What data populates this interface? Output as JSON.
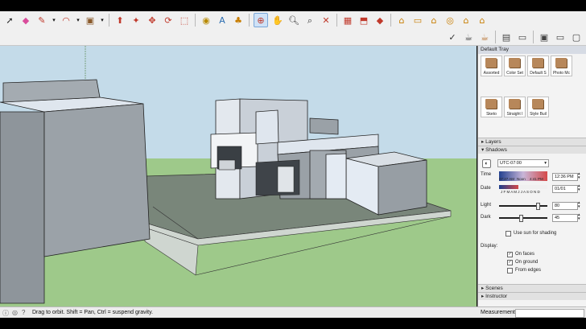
{
  "toolbar": {
    "row1_icons": [
      "select-icon",
      "eraser-icon",
      "pencil-icon",
      "dropdown-icon",
      "arc-icon",
      "dropdown-icon",
      "rectangle-icon",
      "dropdown-icon",
      "push-pull-icon",
      "follow-me-icon",
      "move-icon",
      "rotate-icon",
      "scale-icon",
      "tape-measure-icon",
      "paint-bucket-icon",
      "text-icon",
      "orbit-icon",
      "pan-icon",
      "zoom-icon",
      "zoom-window-icon",
      "zoom-extents-icon",
      "warehouse-icon",
      "extension-icon",
      "ruby-icon",
      "iso-view-icon",
      "top-view-icon",
      "front-view-icon",
      "right-view-icon",
      "back-view-icon",
      "left-view-icon"
    ],
    "row2_icons": [
      "check-icon",
      "teapot-icon",
      "teapot-shaded-icon",
      "section-fill-icon",
      "monitor-icon",
      "monitor-tabs-icon",
      "monitor-icon",
      "xray-icon"
    ]
  },
  "tray": {
    "title": "Default Tray",
    "swatches": [
      "Assorted",
      "Color Set",
      "Default S",
      "Photo Mc",
      "Sketo",
      "Straight I",
      "Style Buil"
    ],
    "sections": {
      "layers": "Layers",
      "shadows": "Shadows",
      "scenes": "Scenes",
      "instructor": "Instructor"
    },
    "shadows": {
      "timezone": "UTC-07:00",
      "time_label": "Time",
      "time_start": "07:27 AM",
      "time_noon": "Noon",
      "time_end": "4:41 PM",
      "time_value": "12:36 PM",
      "date_label": "Date",
      "months": "J F M A M J J A S O N D",
      "date_value": "01/01",
      "light_label": "Light",
      "light_value": "80",
      "dark_label": "Dark",
      "dark_value": "45",
      "use_sun_label": "Use sun for shading",
      "display_label": "Display:",
      "on_faces": "On faces",
      "on_ground": "On ground",
      "from_edges": "From edges",
      "light_level": 0.8,
      "dark_level": 0.45
    }
  },
  "status": {
    "message": "Drag to orbit. Shift = Pan, Ctrl = suspend gravity.",
    "measurements_label": "Measurements"
  },
  "colors": {
    "sky": "#c4dbe9",
    "ground": "#9ec98a",
    "building": "#9fa6ad",
    "building_light": "#dfe6ee",
    "lot": "#6f7b6e"
  }
}
